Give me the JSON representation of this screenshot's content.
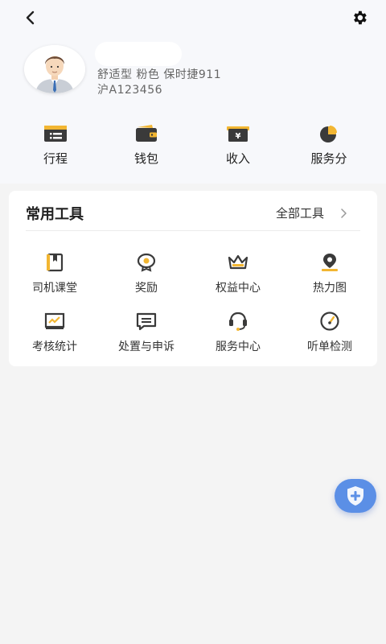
{
  "colors": {
    "accent_yellow": "#f2b632",
    "icon_dark": "#3a3a3a",
    "fab_blue": "#5b8fe6"
  },
  "nav": {
    "back_icon": "chevron-left-icon",
    "settings_icon": "gear-icon"
  },
  "profile": {
    "vehicle": "舒适型 粉色 保时捷911",
    "plate": "沪A123456"
  },
  "quick_actions": [
    {
      "label": "行程",
      "icon": "trip-icon"
    },
    {
      "label": "钱包",
      "icon": "wallet-icon"
    },
    {
      "label": "收入",
      "icon": "income-icon"
    },
    {
      "label": "服务分",
      "icon": "service-score-icon"
    }
  ],
  "tools": {
    "title": "常用工具",
    "all_label": "全部工具",
    "items": [
      {
        "label": "司机课堂",
        "icon": "book-icon"
      },
      {
        "label": "奖励",
        "icon": "reward-icon"
      },
      {
        "label": "权益中心",
        "icon": "crown-icon"
      },
      {
        "label": "热力图",
        "icon": "map-pin-icon"
      },
      {
        "label": "考核统计",
        "icon": "stats-icon"
      },
      {
        "label": "处置与申诉",
        "icon": "message-icon"
      },
      {
        "label": "服务中心",
        "icon": "headset-icon"
      },
      {
        "label": "听单检测",
        "icon": "gauge-icon"
      }
    ]
  },
  "fab": {
    "icon": "shield-plus-icon"
  }
}
